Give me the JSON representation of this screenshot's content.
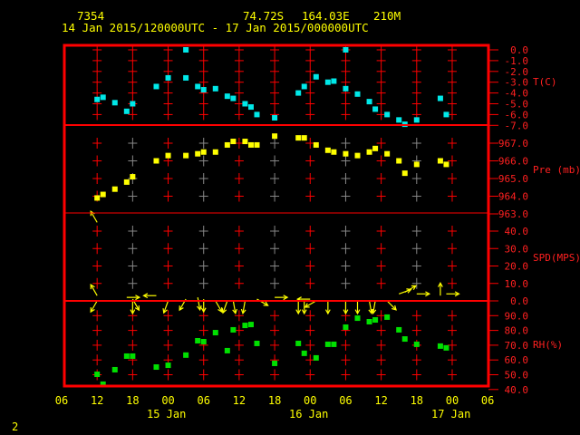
{
  "header": {
    "station": "7354",
    "latitude": "74.72S",
    "longitude": "164.03E",
    "elevation": "210M",
    "time_range": "14 Jan 2015/120000UTC - 17 Jan 2015/000000UTC"
  },
  "footer": {
    "page_number": "2"
  },
  "colors": {
    "frame": "#ff0000",
    "text": "#ffff00",
    "axis_labels": "#ff2020",
    "temperature": "#00e8e8",
    "pressure": "#ffff00",
    "wind": "#ffff00",
    "humidity": "#00e000",
    "minor_grid": "#888888"
  },
  "chart_data": {
    "type": "scatter",
    "x_tick_labels": [
      "06",
      "12",
      "18",
      "00",
      "06",
      "12",
      "18",
      "00",
      "06",
      "12",
      "18",
      "00",
      "06"
    ],
    "x_date_labels": [
      "15 Jan",
      "16 Jan",
      "17 Jan"
    ],
    "xlim": [
      "2015-01-14T06:00",
      "2015-01-17T06:00"
    ],
    "grid": true,
    "panels": [
      {
        "name": "temperature",
        "label": "T(C)",
        "ylim": [
          -7,
          0
        ],
        "tick_labels": [
          "0.0",
          "-1.0",
          "-2.0",
          "-3.0",
          "-4.0",
          "-5.0",
          "-6.0",
          "-7.0"
        ],
        "points": [
          [
            "2015-01-14T12:00",
            -4.6
          ],
          [
            "2015-01-14T13:00",
            -4.4
          ],
          [
            "2015-01-14T15:00",
            -4.9
          ],
          [
            "2015-01-14T17:00",
            -5.7
          ],
          [
            "2015-01-14T18:00",
            -5.0
          ],
          [
            "2015-01-14T22:00",
            -3.4
          ],
          [
            "2015-01-15T00:00",
            -2.6
          ],
          [
            "2015-01-15T03:00",
            0.0
          ],
          [
            "2015-01-15T03:00",
            -2.6
          ],
          [
            "2015-01-15T05:00",
            -3.4
          ],
          [
            "2015-01-15T06:00",
            -3.7
          ],
          [
            "2015-01-15T08:00",
            -3.6
          ],
          [
            "2015-01-15T10:00",
            -4.3
          ],
          [
            "2015-01-15T11:00",
            -4.5
          ],
          [
            "2015-01-15T13:00",
            -5.0
          ],
          [
            "2015-01-15T14:00",
            -5.3
          ],
          [
            "2015-01-15T15:00",
            -6.0
          ],
          [
            "2015-01-15T18:00",
            -6.3
          ],
          [
            "2015-01-15T22:00",
            -4.0
          ],
          [
            "2015-01-15T23:00",
            -3.4
          ],
          [
            "2015-01-16T01:00",
            -2.5
          ],
          [
            "2015-01-16T03:00",
            -3.0
          ],
          [
            "2015-01-16T04:00",
            -2.9
          ],
          [
            "2015-01-16T06:00",
            0.0
          ],
          [
            "2015-01-16T06:00",
            -3.6
          ],
          [
            "2015-01-16T08:00",
            -4.1
          ],
          [
            "2015-01-16T10:00",
            -4.8
          ],
          [
            "2015-01-16T11:00",
            -5.5
          ],
          [
            "2015-01-16T13:00",
            -6.0
          ],
          [
            "2015-01-16T15:00",
            -6.5
          ],
          [
            "2015-01-16T16:00",
            -6.9
          ],
          [
            "2015-01-16T18:00",
            -6.5
          ],
          [
            "2015-01-16T22:00",
            -4.5
          ],
          [
            "2015-01-16T23:00",
            -6.0
          ]
        ]
      },
      {
        "name": "pressure",
        "label": "Pre (mb)",
        "ylim": [
          963,
          968
        ],
        "tick_labels": [
          "967.0",
          "966.0",
          "965.0",
          "964.0",
          "963.0"
        ],
        "points": [
          [
            "2015-01-14T12:00",
            963.9
          ],
          [
            "2015-01-14T13:00",
            964.1
          ],
          [
            "2015-01-14T15:00",
            964.4
          ],
          [
            "2015-01-14T17:00",
            964.8
          ],
          [
            "2015-01-14T18:00",
            965.1
          ],
          [
            "2015-01-14T22:00",
            966.0
          ],
          [
            "2015-01-15T00:00",
            966.3
          ],
          [
            "2015-01-15T03:00",
            966.3
          ],
          [
            "2015-01-15T05:00",
            966.4
          ],
          [
            "2015-01-15T06:00",
            966.5
          ],
          [
            "2015-01-15T08:00",
            966.5
          ],
          [
            "2015-01-15T10:00",
            966.9
          ],
          [
            "2015-01-15T11:00",
            967.1
          ],
          [
            "2015-01-15T13:00",
            967.1
          ],
          [
            "2015-01-15T14:00",
            966.9
          ],
          [
            "2015-01-15T15:00",
            966.9
          ],
          [
            "2015-01-15T18:00",
            967.4
          ],
          [
            "2015-01-15T22:00",
            967.3
          ],
          [
            "2015-01-15T23:00",
            967.3
          ],
          [
            "2015-01-16T01:00",
            966.9
          ],
          [
            "2015-01-16T03:00",
            966.6
          ],
          [
            "2015-01-16T04:00",
            966.5
          ],
          [
            "2015-01-16T06:00",
            966.4
          ],
          [
            "2015-01-16T08:00",
            966.3
          ],
          [
            "2015-01-16T10:00",
            966.5
          ],
          [
            "2015-01-16T11:00",
            966.7
          ],
          [
            "2015-01-16T13:00",
            966.4
          ],
          [
            "2015-01-16T15:00",
            966.0
          ],
          [
            "2015-01-16T16:00",
            965.3
          ],
          [
            "2015-01-16T18:00",
            965.8
          ],
          [
            "2015-01-16T22:00",
            966.0
          ],
          [
            "2015-01-16T23:00",
            965.8
          ]
        ]
      },
      {
        "name": "wind-speed",
        "label": "SPD(MPS)",
        "ylim": [
          0,
          50
        ],
        "tick_labels": [
          "40.0",
          "30.0",
          "20.0",
          "10.0",
          "0.0"
        ],
        "points": [
          [
            "2015-01-14T12:00",
            45,
            120
          ],
          [
            "2015-01-14T12:00",
            3,
            120
          ],
          [
            "2015-01-14T12:00",
            0,
            240
          ],
          [
            "2015-01-14T17:00",
            2,
            0
          ],
          [
            "2015-01-14T18:00",
            1,
            300
          ],
          [
            "2015-01-14T18:00",
            0,
            270
          ],
          [
            "2015-01-14T22:00",
            3,
            180
          ],
          [
            "2015-01-15T00:00",
            0,
            250
          ],
          [
            "2015-01-15T03:00",
            1,
            240
          ],
          [
            "2015-01-15T05:00",
            2,
            280
          ],
          [
            "2015-01-15T06:00",
            1,
            270
          ],
          [
            "2015-01-15T08:00",
            0,
            300
          ],
          [
            "2015-01-15T10:00",
            0,
            250
          ],
          [
            "2015-01-15T11:00",
            0,
            280
          ],
          [
            "2015-01-15T13:00",
            0,
            260
          ],
          [
            "2015-01-15T15:00",
            1,
            330
          ],
          [
            "2015-01-15T18:00",
            2,
            0
          ],
          [
            "2015-01-15T22:00",
            0,
            270
          ],
          [
            "2015-01-15T23:00",
            0,
            270
          ],
          [
            "2015-01-16T00:00",
            1,
            180
          ],
          [
            "2015-01-16T01:00",
            0,
            210
          ],
          [
            "2015-01-16T03:00",
            0,
            270
          ],
          [
            "2015-01-16T06:00",
            0,
            270
          ],
          [
            "2015-01-16T08:00",
            0,
            270
          ],
          [
            "2015-01-16T10:00",
            0,
            280
          ],
          [
            "2015-01-16T11:00",
            0,
            260
          ],
          [
            "2015-01-16T13:00",
            0,
            315
          ],
          [
            "2015-01-16T15:00",
            4,
            20
          ],
          [
            "2015-01-16T16:00",
            5,
            30
          ],
          [
            "2015-01-16T18:00",
            4,
            0
          ],
          [
            "2015-01-16T22:00",
            3,
            90
          ],
          [
            "2015-01-16T23:00",
            4,
            0
          ]
        ]
      },
      {
        "name": "relative-humidity",
        "label": "RH(%)",
        "ylim": [
          40,
          100
        ],
        "tick_labels": [
          "90.0",
          "80.0",
          "70.0",
          "60.0",
          "50.0",
          "40.0"
        ],
        "points": [
          [
            "2015-01-14T12:00",
            50.3
          ],
          [
            "2015-01-14T13:00",
            43.6
          ],
          [
            "2015-01-14T15:00",
            53.4
          ],
          [
            "2015-01-14T17:00",
            62.6
          ],
          [
            "2015-01-14T18:00",
            62.6
          ],
          [
            "2015-01-14T22:00",
            55.2
          ],
          [
            "2015-01-15T00:00",
            56.4
          ],
          [
            "2015-01-15T03:00",
            63.3
          ],
          [
            "2015-01-15T05:00",
            73.0
          ],
          [
            "2015-01-15T06:00",
            72.4
          ],
          [
            "2015-01-15T08:00",
            78.5
          ],
          [
            "2015-01-15T10:00",
            66.3
          ],
          [
            "2015-01-15T11:00",
            80.4
          ],
          [
            "2015-01-15T13:00",
            83.4
          ],
          [
            "2015-01-15T14:00",
            84.0
          ],
          [
            "2015-01-15T15:00",
            71.2
          ],
          [
            "2015-01-15T18:00",
            57.7
          ],
          [
            "2015-01-15T22:00",
            71.2
          ],
          [
            "2015-01-15T23:00",
            64.5
          ],
          [
            "2015-01-16T01:00",
            61.4
          ],
          [
            "2015-01-16T03:00",
            70.6
          ],
          [
            "2015-01-16T04:00",
            70.6
          ],
          [
            "2015-01-16T06:00",
            82.2
          ],
          [
            "2015-01-16T08:00",
            88.3
          ],
          [
            "2015-01-16T10:00",
            85.9
          ],
          [
            "2015-01-16T11:00",
            87.1
          ],
          [
            "2015-01-16T13:00",
            89.0
          ],
          [
            "2015-01-16T15:00",
            80.4
          ],
          [
            "2015-01-16T16:00",
            74.2
          ],
          [
            "2015-01-16T18:00",
            70.6
          ],
          [
            "2015-01-16T22:00",
            69.4
          ],
          [
            "2015-01-16T23:00",
            68.2
          ]
        ]
      }
    ]
  }
}
